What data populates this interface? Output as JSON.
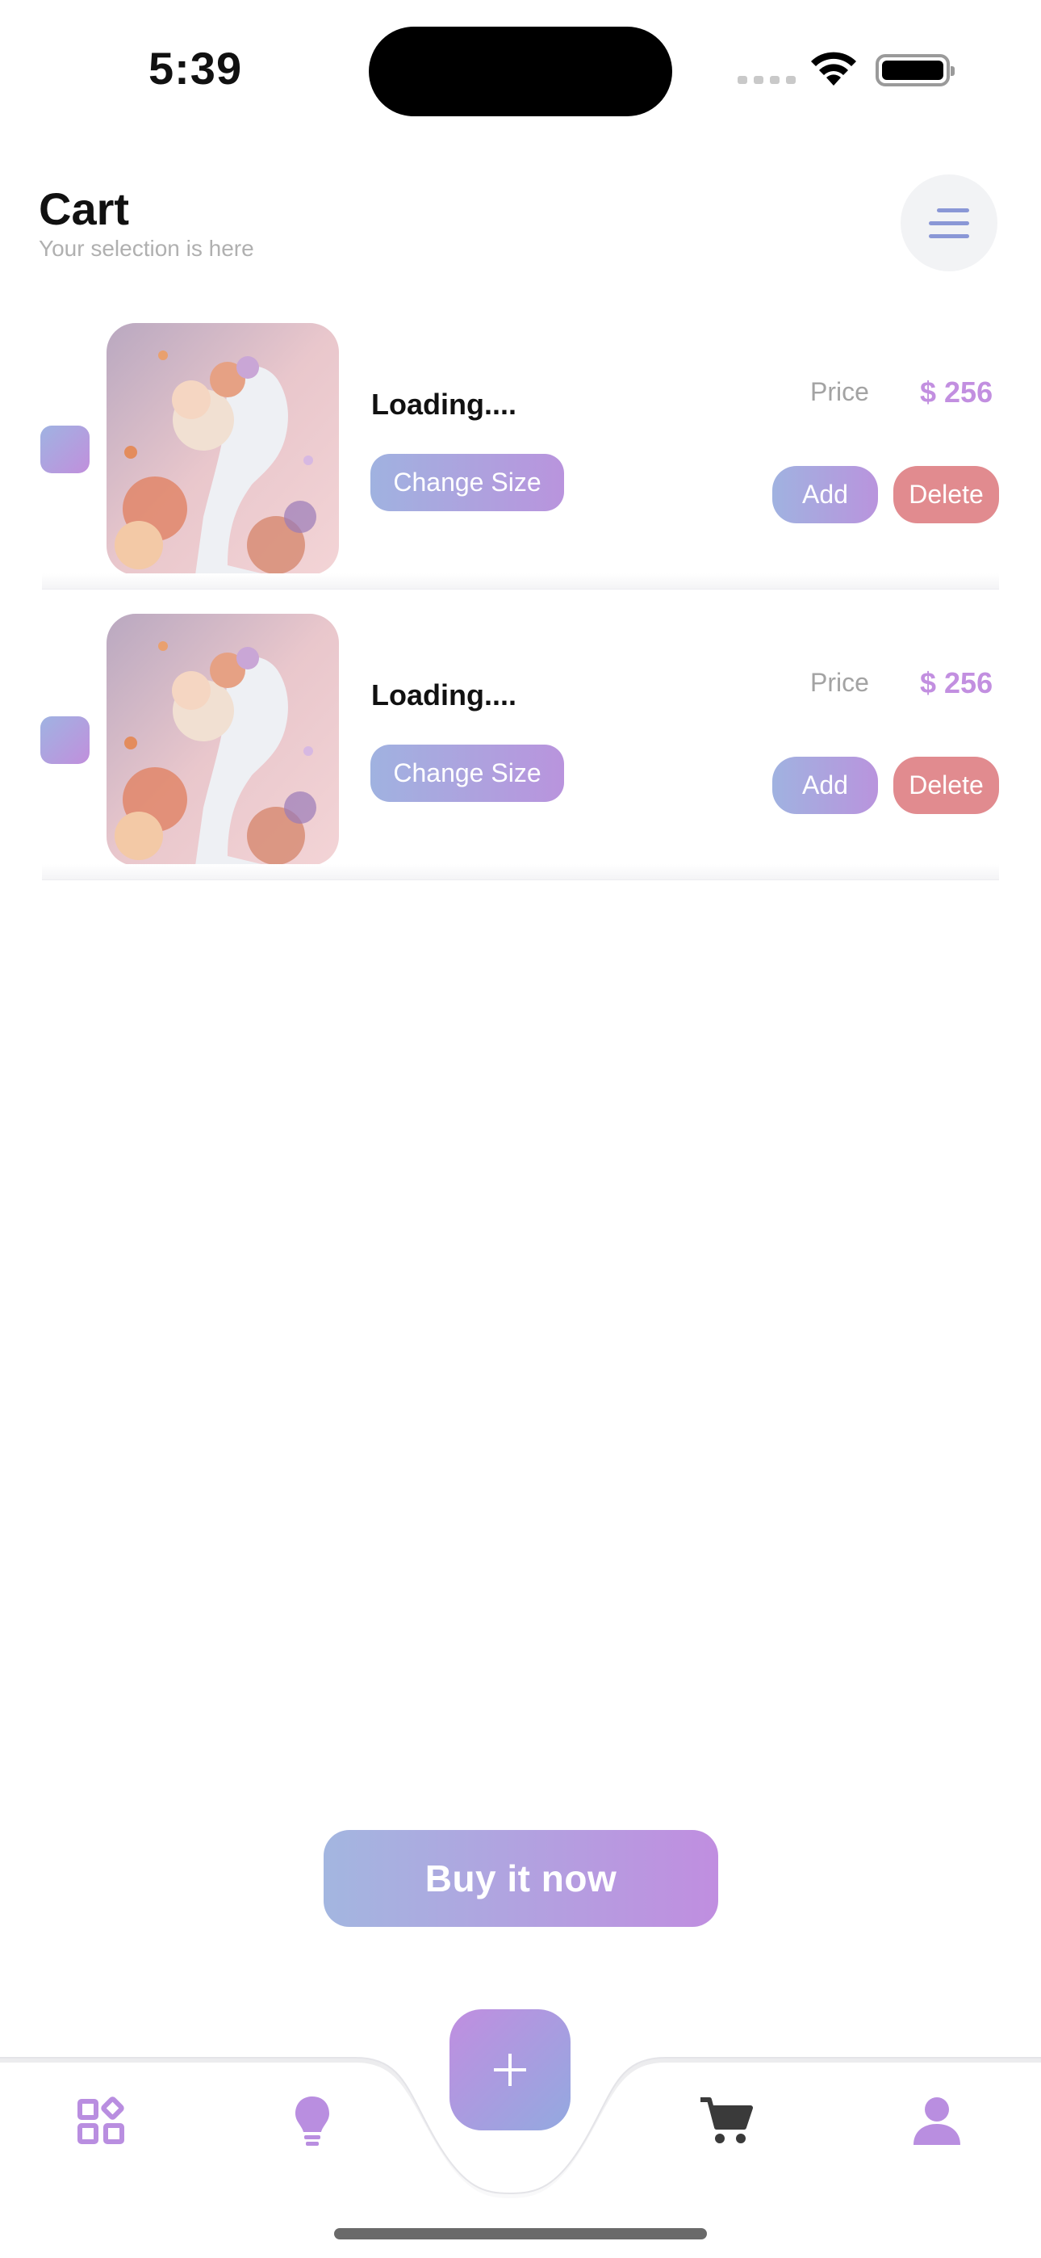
{
  "status_bar": {
    "time": "5:39"
  },
  "header": {
    "title": "Cart",
    "subtitle": "Your selection is here"
  },
  "cart": {
    "items": [
      {
        "name": "Loading....",
        "change_size_label": "Change Size",
        "price_label": "Price",
        "price": "$ 256",
        "add_label": "Add",
        "delete_label": "Delete"
      },
      {
        "name": "Loading....",
        "change_size_label": "Change Size",
        "price_label": "Price",
        "price": "$ 256",
        "add_label": "Add",
        "delete_label": "Delete"
      }
    ]
  },
  "buy_button": {
    "label": "Buy it now"
  },
  "tabbar": {
    "icons": [
      "grid-icon",
      "lightbulb-icon",
      "plus-icon",
      "cart-icon",
      "user-icon"
    ],
    "active": "cart-icon"
  },
  "colors": {
    "accent_start": "#a0b2e0",
    "accent_end": "#c08ee0",
    "delete": "#e18b8f",
    "price": "#c28fe0",
    "tab_icon": "#b98ee0",
    "tab_icon_active": "#3a3a3a"
  }
}
